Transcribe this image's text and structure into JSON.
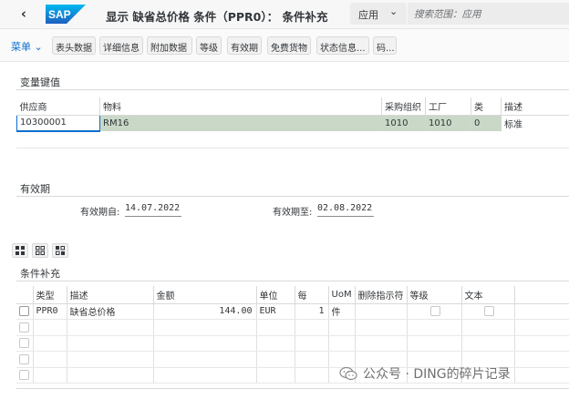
{
  "shell": {
    "back_icon": "chevron-left-icon",
    "logo_text": "SAP",
    "title": "显示 缺省总价格 条件（PPR0）： 条件补充",
    "scope_label": "应用",
    "search_placeholder": "搜索范围：应用",
    "brand_color": "#0a6ed1"
  },
  "toolbar": {
    "menu_label": "菜单",
    "buttons": [
      "表头数据",
      "详细信息",
      "附加数据",
      "等级",
      "有效期",
      "免费货物",
      "状态信息...",
      "码..."
    ]
  },
  "key_section": {
    "title": "变量键值",
    "columns": [
      "供应商",
      "物料",
      "采购组织",
      "工厂",
      "类",
      "描述"
    ],
    "row": {
      "vendor": "10300001",
      "material": "RM16",
      "purch_org": "1010",
      "plant": "1010",
      "class": "0",
      "description": "标准"
    }
  },
  "validity": {
    "title": "有效期",
    "from_label": "有效期自:",
    "from_value": "14.07.2022",
    "to_label": "有效期至:",
    "to_value": "02.08.2022"
  },
  "conditions": {
    "title": "条件补充",
    "columns": [
      "类型",
      "描述",
      "金额",
      "单位",
      "每",
      "UoM",
      "删除指示符",
      "等级",
      "文本"
    ],
    "rows": [
      {
        "type": "PPR0",
        "description": "缺省总价格",
        "amount": "144.00",
        "unit": "EUR",
        "per": "1",
        "uom": "件"
      }
    ]
  },
  "watermark": "公众号 · DING的碎片记录"
}
